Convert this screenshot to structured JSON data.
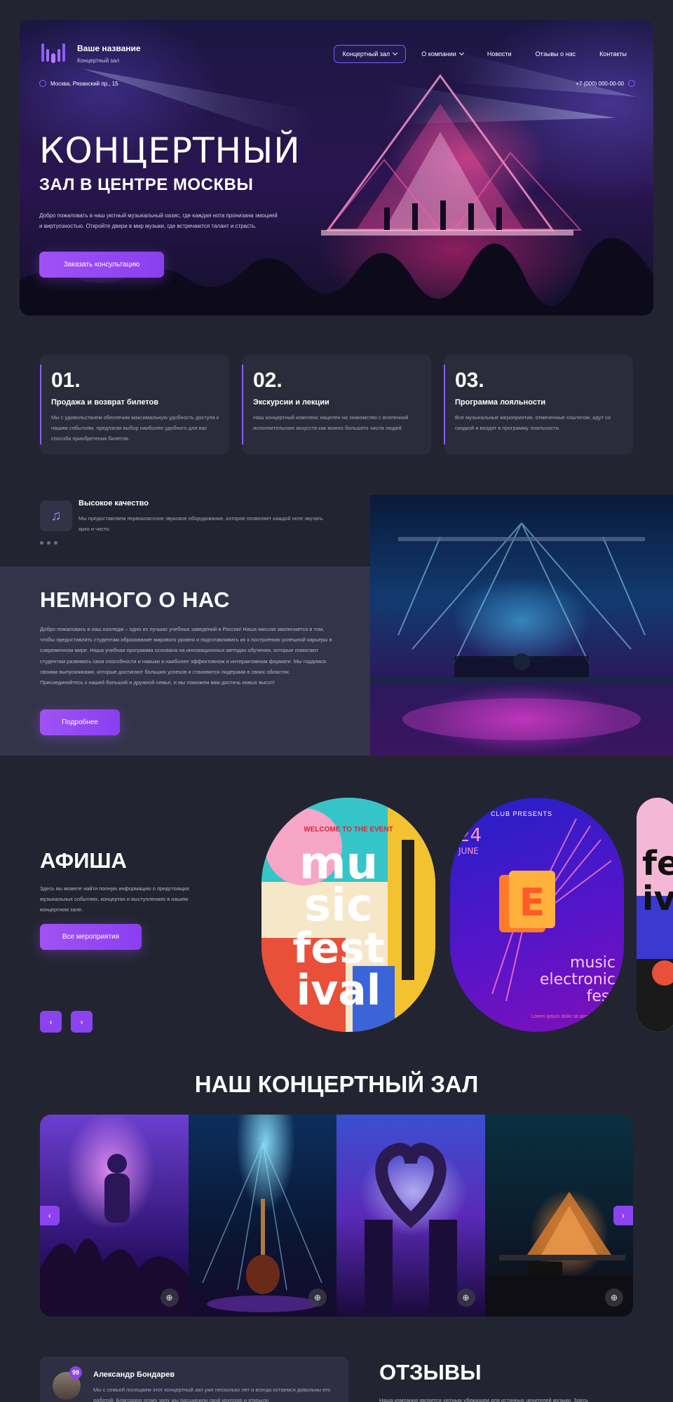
{
  "header": {
    "brand_name": "Ваше название",
    "brand_sub": "Концертный зал",
    "nav": [
      {
        "label": "Концертный зал"
      },
      {
        "label": "О компании"
      },
      {
        "label": "Новости"
      },
      {
        "label": "Отзывы о нас"
      },
      {
        "label": "Контакты"
      }
    ],
    "address": "Москва, Рязанский пр., 15",
    "phone": "+7 (000) 000-00-00"
  },
  "hero": {
    "title_line1": "КОНЦЕРТНЫЙ",
    "title_line2": "ЗАЛ В ЦЕНТРЕ МОСКВЫ",
    "text": "Добро пожаловать в наш уютный музыкальный оазис, где каждая нота пронизана эмоцией и виртуозностью. Откройте двери в мир музыки, где встречаются талант и страсть.",
    "button": "Заказать консультацию"
  },
  "features": [
    {
      "num": "01.",
      "title": "Продажа и возврат билетов",
      "text": "Мы с удовольствием обеспечим максимальную удобность доступа к нашим событиям, предлагая выбор наиболее удобного для вас способа приобретения билетов."
    },
    {
      "num": "02.",
      "title": "Экскурсии и лекции",
      "text": "Наш концертный комплекс нацелен на знакомство с вселенной исполнительских искусств как можно большего числа людей."
    },
    {
      "num": "03.",
      "title": "Программа лояльности",
      "text": "Все музыкальные мероприятия, отмеченные хэштегом, идут со скидкой и входят в программу лояльности."
    }
  ],
  "quality": {
    "title": "Высокое качество",
    "text": "Мы предоставляем первоклассное звуковое оборудование, которое позволяет каждой ноте звучать ярко и чисто."
  },
  "about": {
    "title": "НЕМНОГО О НАС",
    "text": "Добро пожаловать в наш колледж – одно из лучших учебных заведений в России! Наша миссия заключается в том, чтобы предоставлять студентам образование мирового уровня и подготавливать их к построению успешной карьеры в современном мире. Наша учебная программа основана на инновационных методах обучения, которые помогают студентам развивать свои способности и навыки в наиболее эффективном и интерактивном формате. Мы гордимся своими выпускниками, которые достигают больших успехов и становятся лидерами в своих областях. Присоединяйтесь к нашей большой и дружной семье, и мы поможем вам достичь новых высот!",
    "button": "Подробнее"
  },
  "afisha": {
    "title": "АФИША",
    "text": "Здесь вы можете найти полную информацию о предстоящих музыкальных событиях, концертах и выступлениях в нашем концертном зале.",
    "button": "Все мероприятия",
    "prev": "‹",
    "next": "›",
    "poster1": {
      "top": "WELCOME TO THE EVENT",
      "lines": [
        "mu",
        "sic",
        "fest",
        "ival"
      ]
    },
    "poster2": {
      "club": "CLUB PRESENTS",
      "day": "24",
      "month": "JUNE",
      "letter": "E",
      "lines": [
        "music",
        "electronic",
        "fest"
      ],
      "small": "Lorem ipsum dolor sit amet"
    },
    "poster3": {
      "lines": [
        "fe",
        "iv"
      ]
    }
  },
  "hall": {
    "title": "НАШ КОНЦЕРТНЫЙ ЗАЛ",
    "prev": "‹",
    "next": "›",
    "zoom": "⊕"
  },
  "reviews": {
    "title": "ОТЗЫВЫ",
    "text": "Наша компания является уютным убежищем для истинных ценителей музыки. Здесь",
    "badge": "99",
    "card": {
      "name": "Александр Бондарев",
      "text": "Мы с семьей посещаем этот концертный зал уже несколько лет и всегда остаемся довольны его работой. Благодаря этому залу мы расширили свой кругозор и открыли"
    }
  },
  "colors": {
    "accent": "#8b43f0",
    "background": "#232431",
    "card": "#2b2c3b"
  }
}
